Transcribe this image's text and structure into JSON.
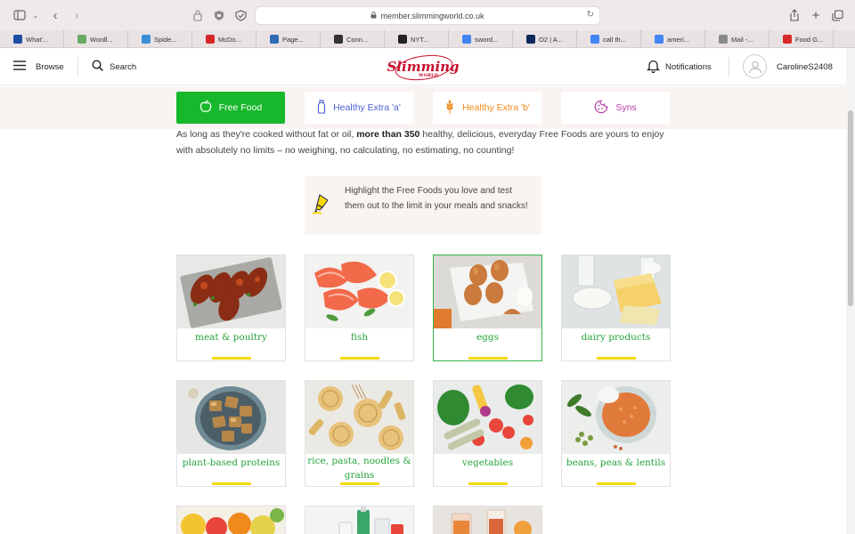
{
  "browser": {
    "url": "member.slimmingworld.co.uk",
    "bookmarks": [
      {
        "label": "What'...",
        "color": "#1f4fa5"
      },
      {
        "label": "Wordl...",
        "color": "#6aaa64"
      },
      {
        "label": "Spide...",
        "color": "#3a8fd9"
      },
      {
        "label": "McDo...",
        "color": "#d62828"
      },
      {
        "label": "Page...",
        "color": "#2f6bb5"
      },
      {
        "label": "Conn...",
        "color": "#333333"
      },
      {
        "label": "NYT...",
        "color": "#222222"
      },
      {
        "label": "sword...",
        "color": "#4285f4"
      },
      {
        "label": "O2 | A...",
        "color": "#0b2a5b"
      },
      {
        "label": "call th...",
        "color": "#4285f4"
      },
      {
        "label": "ameri...",
        "color": "#4285f4"
      },
      {
        "label": "Mail -...",
        "color": "#8a8a8a"
      },
      {
        "label": "Food G...",
        "color": "#d62828"
      }
    ]
  },
  "header": {
    "browse_label": "Browse",
    "search_label": "Search",
    "logo_text": "Slimming",
    "logo_sub": "WORLD",
    "notifications_label": "Notifications",
    "username": "CarolineS2408"
  },
  "tabs": [
    {
      "label": "Free Food",
      "icon": "apple-icon",
      "color": "#ffffff",
      "bg": "#17b82b",
      "active": true
    },
    {
      "label": "Healthy Extra 'a'",
      "icon": "milk-bottle-icon",
      "color": "#4a5fd6",
      "bg": "#ffffff",
      "active": false
    },
    {
      "label": "Healthy Extra 'b'",
      "icon": "wheat-icon",
      "color": "#f08a1c",
      "bg": "#ffffff",
      "active": false
    },
    {
      "label": "Syns",
      "icon": "cookie-icon",
      "color": "#b53ea6",
      "bg": "#ffffff",
      "active": false
    }
  ],
  "intro": {
    "part1": "As long as they're cooked without fat or oil, ",
    "bold": "more than 350",
    "part2": " healthy, delicious, everyday Free Foods are yours to enjoy with absolutely no limits – no weighing, no calculating, no estimating, no counting!"
  },
  "tip": {
    "text": "Highlight the Free Foods you love and test them out to the limit in your meals and snacks!"
  },
  "categories": [
    {
      "label": "meat & poultry",
      "image": "meat-image"
    },
    {
      "label": "fish",
      "image": "fish-image"
    },
    {
      "label": "eggs",
      "image": "eggs-image"
    },
    {
      "label": "dairy products",
      "image": "dairy-image"
    },
    {
      "label": "plant-based proteins",
      "image": "tofu-image"
    },
    {
      "label": "rice, pasta, noodles & grains",
      "image": "pasta-image"
    },
    {
      "label": "vegetables",
      "image": "vegetables-image"
    },
    {
      "label": "beans, peas & lentils",
      "image": "lentils-image"
    }
  ],
  "colors": {
    "brand_red": "#c8102e",
    "free_food_green": "#17b82b",
    "label_green": "#24a33a",
    "underline_yellow": "#f6d80a",
    "band_bg": "#f9f3f1"
  }
}
